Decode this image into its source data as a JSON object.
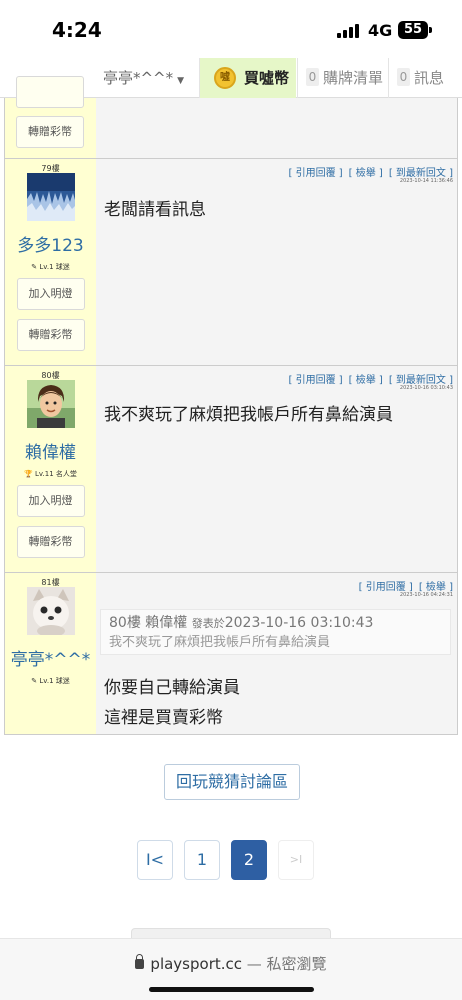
{
  "status": {
    "time": "4:24",
    "network": "4G",
    "battery": "55"
  },
  "nav": {
    "user": "亭亭*^^*",
    "coin_label": "買噓幣",
    "coin_icon_text": "噓",
    "list_count": "0",
    "list_label": "購牌清單",
    "msg_count": "0",
    "msg_label": "訊息"
  },
  "side_buttons": {
    "light": "加入明燈",
    "gift": "轉贈彩幣"
  },
  "actions": {
    "quote": "[ 引用回覆 ]",
    "report": "[ 檢舉 ]",
    "latest": "[ 到最新回文 ]"
  },
  "posts": [
    {
      "floor": "79樓",
      "username": "多多123",
      "level": "✎ Lv.1 球迷",
      "time": "2023-10-14 11:36:46",
      "body": "老闆請看訊息"
    },
    {
      "floor": "80樓",
      "username": "賴偉權",
      "level": "🏆 Lv.11 名人堂",
      "time": "2023-10-16 03:10:43",
      "body": "我不爽玩了麻煩把我帳戶所有鼻給演員"
    },
    {
      "floor": "81樓",
      "username": "亭亭*^^*",
      "level": "✎ Lv.1 球迷",
      "time": "2023-10-16 04:24:31",
      "quote": {
        "header": "80樓 賴偉權",
        "label": "發表於",
        "time": "2023-10-16 03:10:43",
        "text": "我不爽玩了麻煩把我帳戶所有鼻給演員"
      },
      "body_line1": "你要自己轉給演員",
      "body_line2": "這裡是買賣彩幣"
    }
  ],
  "back_button": "回玩競猜討論區",
  "pagination": {
    "first": "I<",
    "page1": "1",
    "page2": "2",
    "last": ">I"
  },
  "browser": {
    "domain": "playsport.cc",
    "private": " — 私密瀏覽"
  },
  "colors": {
    "link": "#2e6da4",
    "sidebar": "#ffffd2",
    "coin_bg": "#e6f7c8",
    "current_page": "#2e5fa3"
  }
}
